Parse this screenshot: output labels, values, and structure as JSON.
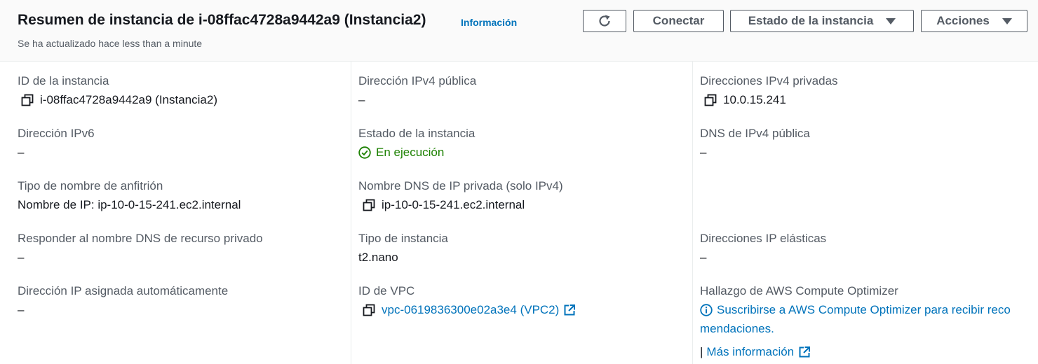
{
  "header": {
    "title": "Resumen de instancia de i-08ffac4728a9442a9 (Instancia2)",
    "info_link": "Información",
    "subtitle": "Se ha actualizado hace less than a minute",
    "buttons": {
      "refresh_icon": "refresh-icon",
      "connect": "Conectar",
      "instance_state": "Estado de la instancia",
      "actions": "Acciones"
    }
  },
  "fields": {
    "instance_id": {
      "label": "ID de la instancia",
      "value": "i-08ffac4728a9442a9 (Instancia2)"
    },
    "ipv6": {
      "label": "Dirección IPv6",
      "value": "–"
    },
    "hostname_type": {
      "label": "Tipo de nombre de anfitrión",
      "value": "Nombre de IP: ip-10-0-15-241.ec2.internal"
    },
    "private_dns_answer": {
      "label": "Responder al nombre DNS de recurso privado",
      "value": "–"
    },
    "auto_ip": {
      "label": "Dirección IP asignada automáticamente",
      "value": "–"
    },
    "public_ipv4": {
      "label": "Dirección IPv4 pública",
      "value": "–"
    },
    "instance_state": {
      "label": "Estado de la instancia",
      "value": "En ejecución"
    },
    "private_dns": {
      "label": "Nombre DNS de IP privada (solo IPv4)",
      "value": "ip-10-0-15-241.ec2.internal"
    },
    "instance_type": {
      "label": "Tipo de instancia",
      "value": "t2.nano"
    },
    "vpc_id": {
      "label": "ID de VPC",
      "value": "vpc-0619836300e02a3e4 (VPC2)"
    },
    "private_ipv4": {
      "label": "Direcciones IPv4 privadas",
      "value": "10.0.15.241"
    },
    "public_ipv4_dns": {
      "label": "DNS de IPv4 pública",
      "value": "–"
    },
    "elastic_ips": {
      "label": "Direcciones IP elásticas",
      "value": "–"
    },
    "optimizer": {
      "label": "Hallazgo de AWS Compute Optimizer",
      "link_line1": "Suscribirse a AWS Compute Optimizer para recibir reco",
      "link_line2": "mendaciones.",
      "separator": "|",
      "more_info": "Más información"
    }
  },
  "colors": {
    "link": "#0073bb",
    "success": "#1d8102",
    "label": "#545b64",
    "text": "#16191f"
  }
}
